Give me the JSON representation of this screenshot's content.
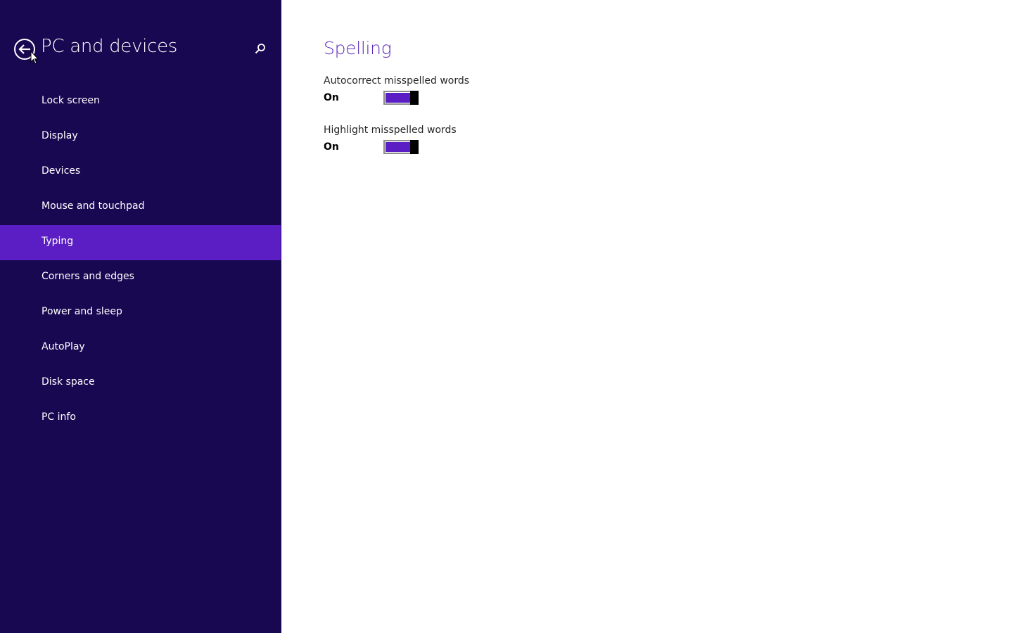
{
  "colors": {
    "sidebar_bg": "#180852",
    "accent": "#5b1ec4",
    "section_title": "#5c2ab8"
  },
  "sidebar": {
    "title": "PC and devices",
    "back_icon": "back-arrow-circle-icon",
    "search_icon": "search-icon",
    "items": [
      {
        "label": "Lock screen",
        "selected": false
      },
      {
        "label": "Display",
        "selected": false
      },
      {
        "label": "Devices",
        "selected": false
      },
      {
        "label": "Mouse and touchpad",
        "selected": false
      },
      {
        "label": "Typing",
        "selected": true
      },
      {
        "label": "Corners and edges",
        "selected": false
      },
      {
        "label": "Power and sleep",
        "selected": false
      },
      {
        "label": "AutoPlay",
        "selected": false
      },
      {
        "label": "Disk space",
        "selected": false
      },
      {
        "label": "PC info",
        "selected": false
      }
    ]
  },
  "main": {
    "section_title": "Spelling",
    "settings": [
      {
        "label": "Autocorrect misspelled words",
        "state": "On",
        "enabled": true
      },
      {
        "label": "Highlight misspelled words",
        "state": "On",
        "enabled": true
      }
    ]
  }
}
